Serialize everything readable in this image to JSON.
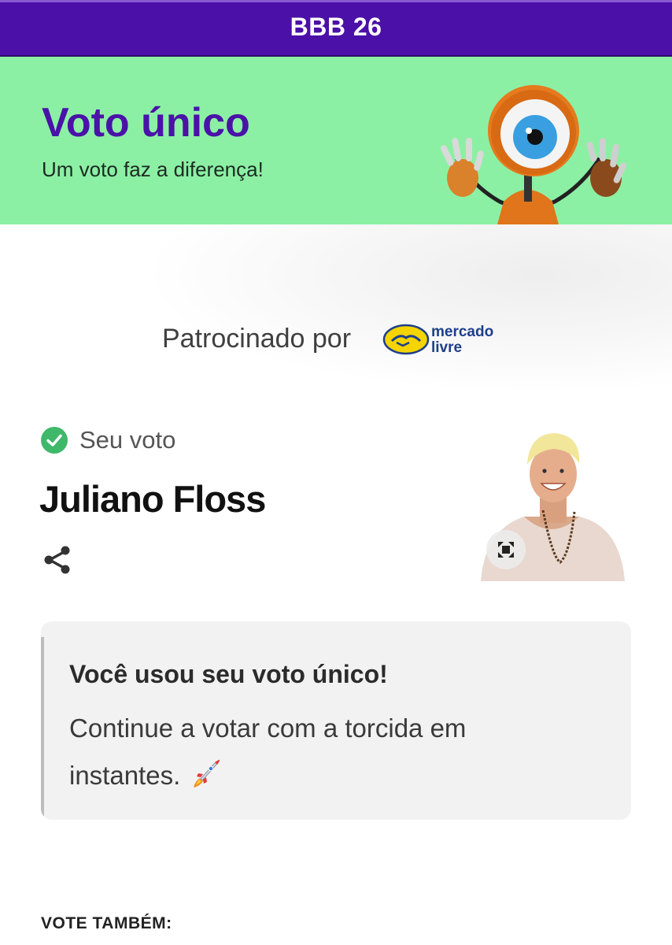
{
  "header": {
    "title": "BBB 26"
  },
  "banner": {
    "title": "Voto único",
    "subtitle": "Um voto faz a diferença!",
    "mascot": "big-brother-eye-robot",
    "background_color": "#8cf0a4",
    "title_color": "#4a12a8"
  },
  "sponsor": {
    "label": "Patrocinado por",
    "logo_line1": "mercado",
    "logo_line2": "livre"
  },
  "vote": {
    "status_label": "Seu voto",
    "status_icon": "check-circle-icon",
    "candidate_name": "Juliano Floss",
    "share_icon": "share-icon",
    "expand_icon": "expand-icon"
  },
  "notice": {
    "title": "Você usou seu voto único!",
    "text": "Continue a votar com a torcida em instantes.",
    "emoji_icon": "rocket-icon"
  },
  "footer": {
    "section_label": "VOTE TAMBÉM:"
  },
  "colors": {
    "header": "#4b10a8",
    "accent_green": "#3fb86a",
    "card_background": "#f2f2f2"
  }
}
